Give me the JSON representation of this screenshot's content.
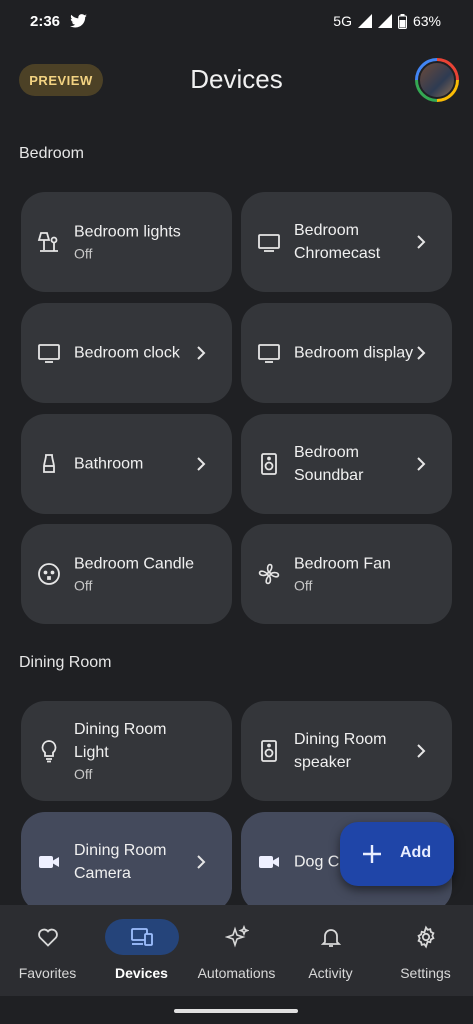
{
  "status_bar": {
    "time": "2:36",
    "network": "5G",
    "battery": "63%"
  },
  "header": {
    "preview_badge": "PREVIEW",
    "title": "Devices"
  },
  "sections": [
    {
      "title": "Bedroom"
    },
    {
      "title": "Dining Room"
    }
  ],
  "devices": [
    {
      "name": "Bedroom lights",
      "status": "Off",
      "icon": "lamp-icon"
    },
    {
      "name": "Bedroom Chromecast",
      "status": "",
      "icon": "tv-icon"
    },
    {
      "name": "Bedroom clock",
      "status": "",
      "icon": "display-icon"
    },
    {
      "name": "Bedroom display",
      "status": "",
      "icon": "display-icon"
    },
    {
      "name": "Bathroom",
      "status": "",
      "icon": "lamp-shade-icon"
    },
    {
      "name": "Bedroom Soundbar",
      "status": "",
      "icon": "speaker-icon"
    },
    {
      "name": "Bedroom Candle",
      "status": "Off",
      "icon": "plug-icon"
    },
    {
      "name": "Bedroom Fan",
      "status": "Off",
      "icon": "fan-icon"
    },
    {
      "name": "Dining Room Light",
      "status": "Off",
      "icon": "bulb-icon"
    },
    {
      "name": "Dining Room speaker",
      "status": "",
      "icon": "speaker-icon"
    },
    {
      "name": "Dining Room Camera",
      "status": "",
      "icon": "camera-icon"
    },
    {
      "name": "Dog C",
      "status": "",
      "icon": "camera-icon"
    }
  ],
  "fab": {
    "label": "Add"
  },
  "nav": [
    {
      "label": "Favorites",
      "icon": "heart-icon"
    },
    {
      "label": "Devices",
      "icon": "devices-icon",
      "selected": true
    },
    {
      "label": "Automations",
      "icon": "sparkle-icon"
    },
    {
      "label": "Activity",
      "icon": "bell-icon"
    },
    {
      "label": "Settings",
      "icon": "gear-icon"
    }
  ],
  "colors": {
    "background": "#1f2023",
    "tile": "#34363a",
    "tile_active": "#444a5c",
    "fab": "#1f45a8",
    "nav_selected": "#25447a",
    "preview_badge": "#4c4126"
  }
}
